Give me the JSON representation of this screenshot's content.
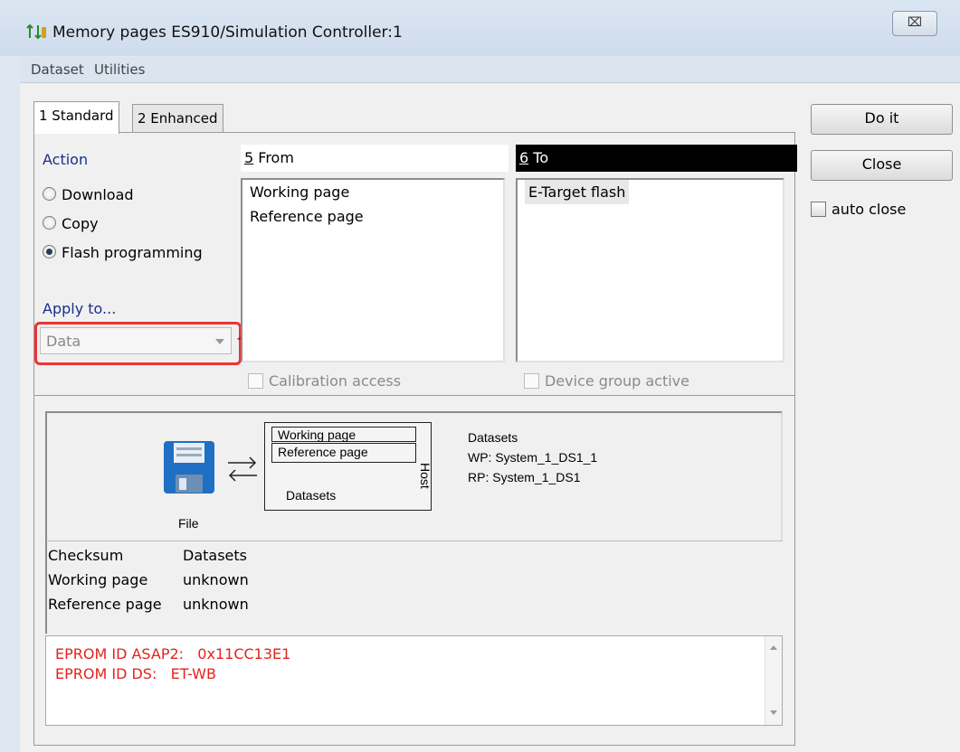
{
  "window": {
    "title": "Memory pages ES910/Simulation Controller:1",
    "close_label": "⌧"
  },
  "menu": [
    "Dataset",
    "Utilities"
  ],
  "tabs": [
    "1 Standard",
    "2 Enhanced"
  ],
  "action": {
    "heading": "Action",
    "options": [
      "Download",
      "Copy",
      "Flash programming"
    ],
    "selected": "Flash programming"
  },
  "apply_to": {
    "label": "Apply to...",
    "value": "Data"
  },
  "from": {
    "header": "5 From",
    "items": [
      "Working page",
      "Reference page"
    ],
    "checkbox": "Calibration access"
  },
  "to": {
    "header": "6 To",
    "items": [
      "E-Target flash"
    ],
    "checkbox": "Device group active"
  },
  "buttons": {
    "do_it": "Do it",
    "close": "Close",
    "auto_close": "auto close"
  },
  "diagram": {
    "file_label": "File",
    "box_rows": [
      "Working page",
      "Reference page"
    ],
    "box_label": "Datasets",
    "host_label": "Host",
    "datasets_heading": "Datasets",
    "wp": "WP: System_1_DS1_1",
    "rp": "RP: System_1_DS1"
  },
  "checksum": {
    "headers": [
      "Checksum",
      "Datasets"
    ],
    "rows": [
      {
        "name": "Working page",
        "value": "unknown"
      },
      {
        "name": "Reference page",
        "value": "unknown"
      }
    ]
  },
  "log": [
    "EPROM ID ASAP2:   0x11CC13E1",
    "EPROM ID DS:   ET-WB"
  ],
  "colors": {
    "accent_red": "#e3231c",
    "label_blue": "#1a2e8f",
    "to_header_bg": "#000000"
  }
}
